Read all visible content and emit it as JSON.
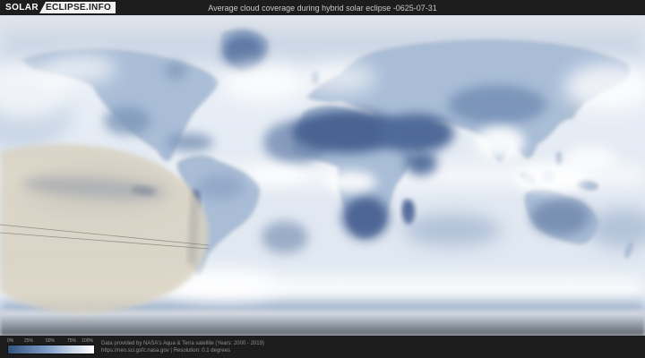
{
  "header": {
    "logo": {
      "primary": "SOLAR",
      "secondary": "ECLIPSE.INFO"
    },
    "title": "Average cloud coverage during hybrid solar eclipse -0625-07-31",
    "background_color": "#1d1d1d"
  },
  "map": {
    "kind": "world-cloud-coverage-map",
    "palette": {
      "clear_sky_dark_blue": "#4a6492",
      "overcast_white": "#ffffff",
      "ocean_base": "#e3eaf3",
      "eclipse_overlay_beige": "#d9d1bf",
      "antarctica_gray": "#7c828c"
    }
  },
  "legend": {
    "ticks": [
      "0%",
      "25%",
      "50%",
      "75%",
      "100%"
    ],
    "gradient_start": "#33547e",
    "gradient_end": "#ffffff"
  },
  "footer": {
    "attribution_line1": "Data provided by NASA's Aqua & Terra satellite (Years: 2000 - 2019)",
    "attribution_line2": "https://neo.sci.gsfc.nasa.gov | Resolution: 0.1 degrees",
    "background_color": "#1d1d1d"
  }
}
